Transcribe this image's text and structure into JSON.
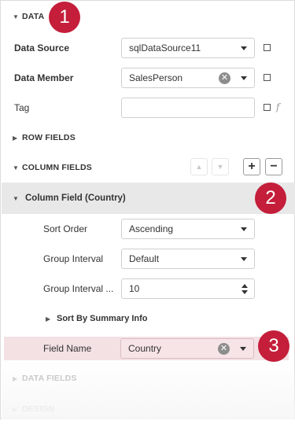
{
  "sections": {
    "data": "DATA",
    "row_fields": "ROW FIELDS",
    "column_fields": "COLUMN FIELDS",
    "data_fields": "DATA FIELDS",
    "design": "DESIGN"
  },
  "data_props": {
    "data_source": {
      "label": "Data Source",
      "value": "sqlDataSource11"
    },
    "data_member": {
      "label": "Data Member",
      "value": "SalesPerson"
    },
    "tag": {
      "label": "Tag",
      "value": "",
      "fx": "f"
    }
  },
  "column_fields_buttons": {
    "up": "▲",
    "down": "▼",
    "add": "+",
    "remove": "−"
  },
  "column_field": {
    "title": "Column Field (Country)",
    "sort_order": {
      "label": "Sort Order",
      "value": "Ascending"
    },
    "group_interval": {
      "label": "Group Interval",
      "value": "Default"
    },
    "group_interval_number": {
      "label": "Group Interval ...",
      "value": "10"
    },
    "sort_by_summary": "Sort By Summary Info",
    "field_name": {
      "label": "Field Name",
      "value": "Country"
    }
  },
  "callouts": [
    "1",
    "2",
    "3"
  ],
  "colors": {
    "callout": "#c41e3a",
    "group_header_bg": "#e8e8e8",
    "highlight_bg": "#f3e1e4"
  },
  "icons": {
    "expand": "triangle-right-icon",
    "collapse": "triangle-down-icon",
    "clear": "clear-circle-icon",
    "dropdown": "caret-down-icon",
    "function": "function-f-icon"
  }
}
